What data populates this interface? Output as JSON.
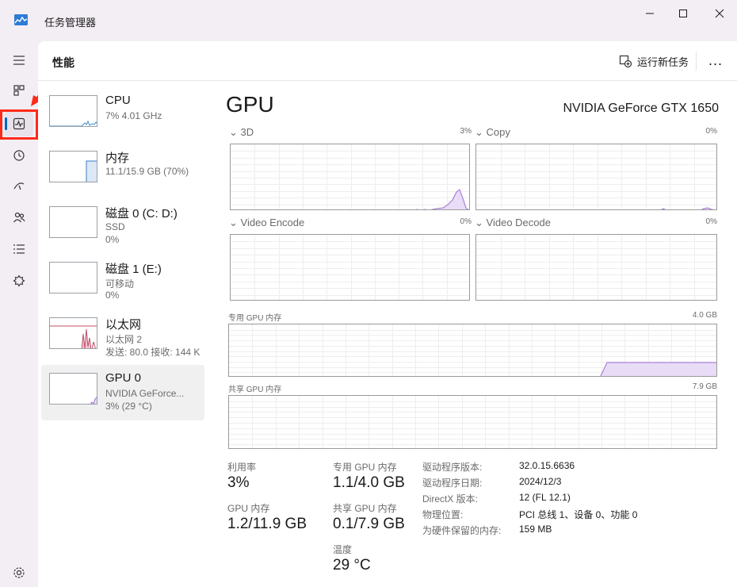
{
  "window": {
    "title": "任务管理器",
    "controls": [
      "minimize-icon",
      "maximize-icon",
      "close-icon"
    ]
  },
  "rail": {
    "items": [
      "menu-icon",
      "processes-icon",
      "performance-icon",
      "app-history-icon",
      "startup-icon",
      "users-icon",
      "details-icon",
      "services-icon",
      "settings-icon"
    ],
    "active": "performance-icon",
    "highlight_color": "#ff2a1a"
  },
  "header": {
    "title": "性能",
    "run_task": "运行新任务",
    "more": "..."
  },
  "devices": [
    {
      "name": "CPU",
      "sub1": "7% 4.01 GHz",
      "sub2": ""
    },
    {
      "name": "内存",
      "sub1": "11.1/15.9 GB (70%)",
      "sub2": ""
    },
    {
      "name": "磁盘 0 (C: D:)",
      "sub1": "SSD",
      "sub2": "0%"
    },
    {
      "name": "磁盘 1 (E:)",
      "sub1": "可移动",
      "sub2": "0%"
    },
    {
      "name": "以太网",
      "sub1": "以太网 2",
      "sub2": "发送: 80.0 接收: 144 K"
    },
    {
      "name": "GPU 0",
      "sub1": "NVIDIA GeForce...",
      "sub2": "3% (29 °C)"
    }
  ],
  "gpu": {
    "title": "GPU",
    "model": "NVIDIA GeForce GTX 1650",
    "engines": [
      {
        "label": "3D",
        "value": "3%"
      },
      {
        "label": "Copy",
        "value": "0%"
      },
      {
        "label": "Video Encode",
        "value": "0%"
      },
      {
        "label": "Video Decode",
        "value": "0%"
      }
    ],
    "dedicated": {
      "label": "专用 GPU 内存",
      "max": "4.0 GB"
    },
    "shared": {
      "label": "共享 GPU 内存",
      "max": "7.9 GB"
    }
  },
  "stats": {
    "utilization": {
      "label": "利用率",
      "value": "3%"
    },
    "dedicated_mem": {
      "label": "专用 GPU 内存",
      "value": "1.1/4.0 GB"
    },
    "gpu_mem": {
      "label": "GPU 内存",
      "value": "1.2/11.9 GB"
    },
    "shared_mem": {
      "label": "共享 GPU 内存",
      "value": "0.1/7.9 GB"
    },
    "temperature": {
      "label": "温度",
      "value": "29 °C"
    }
  },
  "info": [
    {
      "label": "驱动程序版本:",
      "value": "32.0.15.6636"
    },
    {
      "label": "驱动程序日期:",
      "value": "2024/12/3"
    },
    {
      "label": "DirectX 版本:",
      "value": "12 (FL 12.1)"
    },
    {
      "label": "物理位置:",
      "value": "PCI 总线 1、设备 0、功能 0"
    },
    {
      "label": "为硬件保留的内存:",
      "value": "159 MB"
    }
  ],
  "colors": {
    "gpu_line": "#9b6fd0",
    "gpu_fill": "#e8dcf6",
    "grid": "#eeeeee",
    "accent": "#0067c0"
  }
}
